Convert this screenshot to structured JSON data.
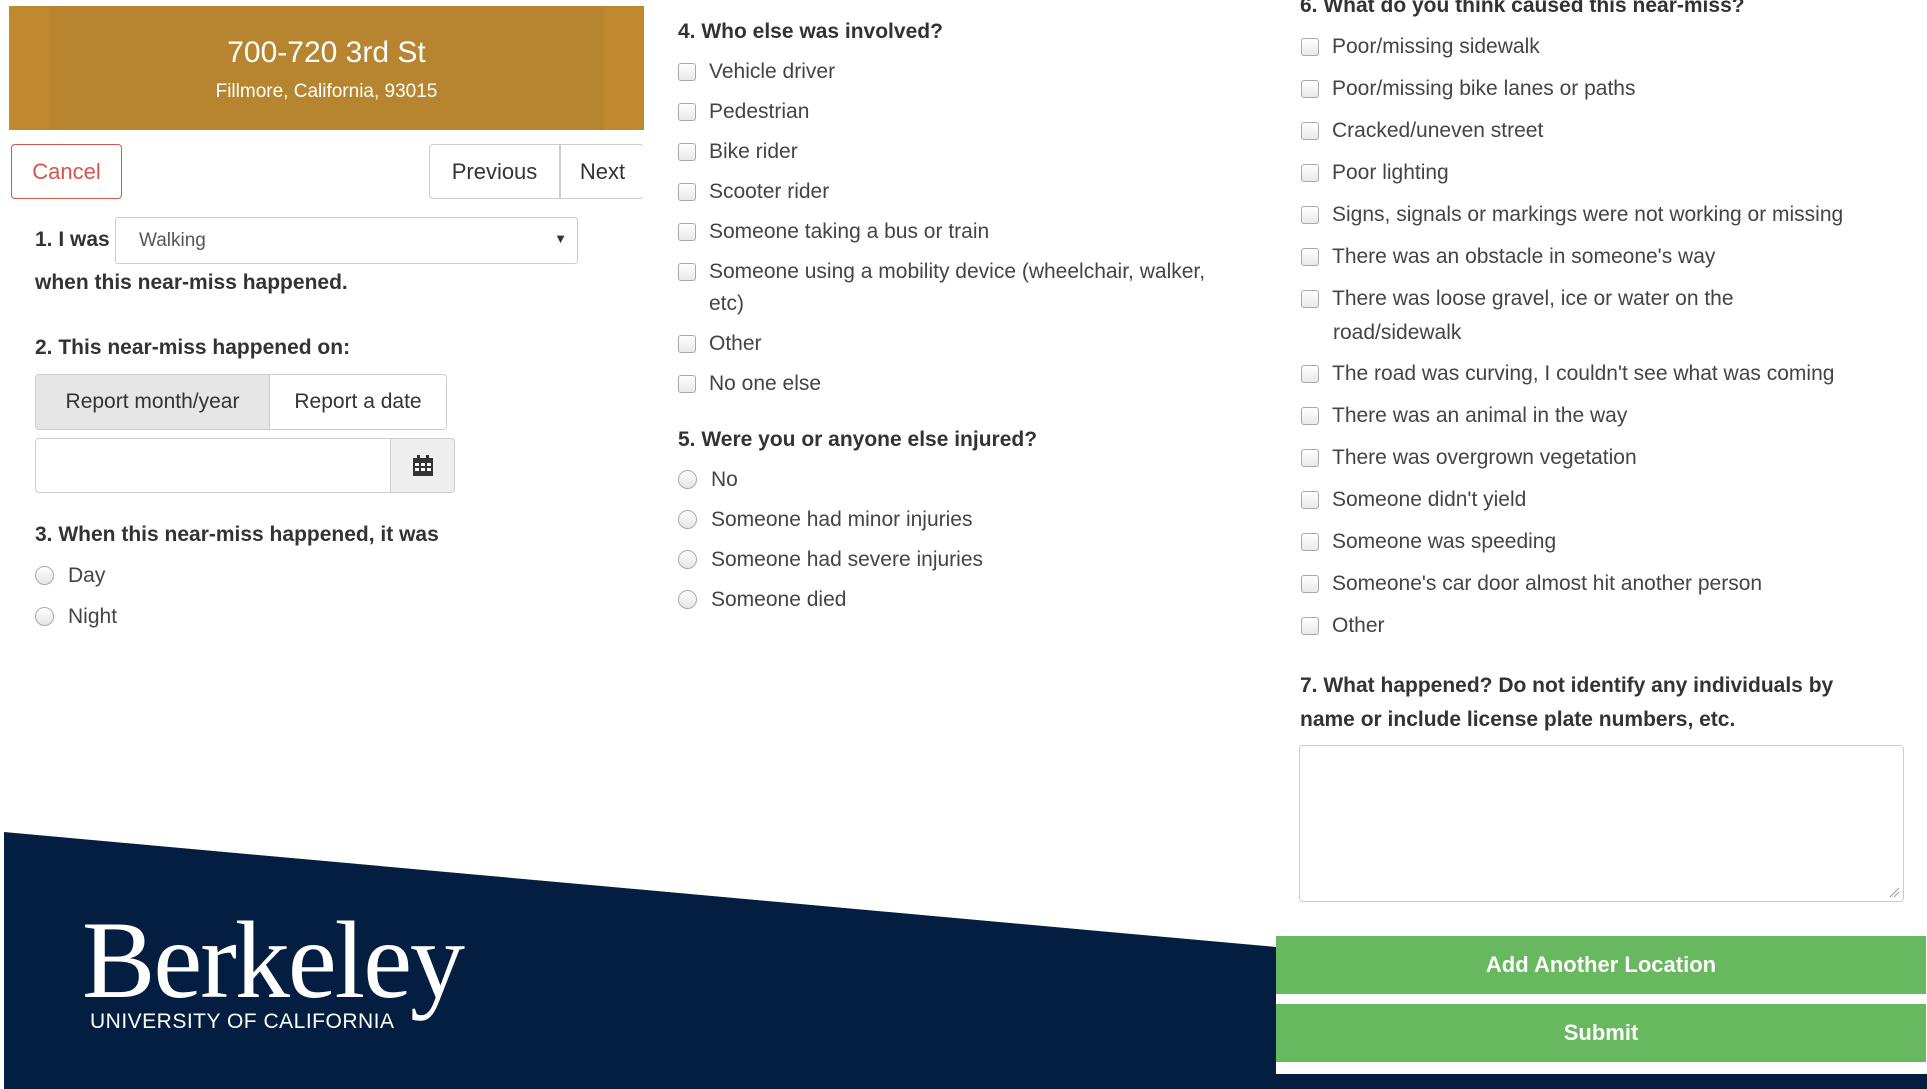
{
  "header": {
    "street": "700-720 3rd St",
    "city": "Fillmore, California, 93015"
  },
  "nav": {
    "cancel": "Cancel",
    "previous": "Previous",
    "next": "Next"
  },
  "q1": {
    "prefix": "1. I was",
    "selected": "Walking",
    "suffix": "when this near-miss happened."
  },
  "q2": {
    "label": "2. This near-miss happened on:",
    "option_a": "Report month/year",
    "option_b": "Report a date",
    "date_value": ""
  },
  "q3": {
    "label": "3. When this near-miss happened, it was",
    "options": [
      "Day",
      "Night"
    ]
  },
  "q4": {
    "label": "4. Who else was involved?",
    "options": [
      "Vehicle driver",
      "Pedestrian",
      "Bike rider",
      "Scooter rider",
      "Someone taking a bus or train",
      "Someone using a mobility device (wheelchair, walker,",
      "etc)",
      "Other",
      "No one else"
    ]
  },
  "q5": {
    "label": "5. Were you or anyone else injured?",
    "options": [
      "No",
      "Someone had minor injuries",
      "Someone had severe injuries",
      "Someone died"
    ]
  },
  "q6": {
    "label": "6. What do you think caused this near-miss?",
    "options": [
      "Poor/missing sidewalk",
      "Poor/missing bike lanes or paths",
      "Cracked/uneven street",
      "Poor lighting",
      "Signs, signals or markings were not working or missing",
      "There was an obstacle in someone's way",
      "There was loose gravel, ice or water on the",
      "road/sidewalk",
      "The road was curving, I couldn't see what was coming",
      "There was an animal in the way",
      "There was overgrown vegetation",
      "Someone didn't yield",
      "Someone was speeding",
      "Someone's car door almost hit another person",
      "Other"
    ]
  },
  "q7": {
    "label_line1": "7. What happened? Do not identify any individuals by",
    "label_line2": "name or include license plate numbers, etc.",
    "value": ""
  },
  "actions": {
    "add_location": "Add Another Location",
    "submit": "Submit"
  },
  "brand": {
    "wordmark": "Berkeley",
    "subtitle": "UNIVERSITY OF CALIFORNIA",
    "navy": "#041e42",
    "accent": "#b7842f",
    "green": "#68b85f"
  }
}
